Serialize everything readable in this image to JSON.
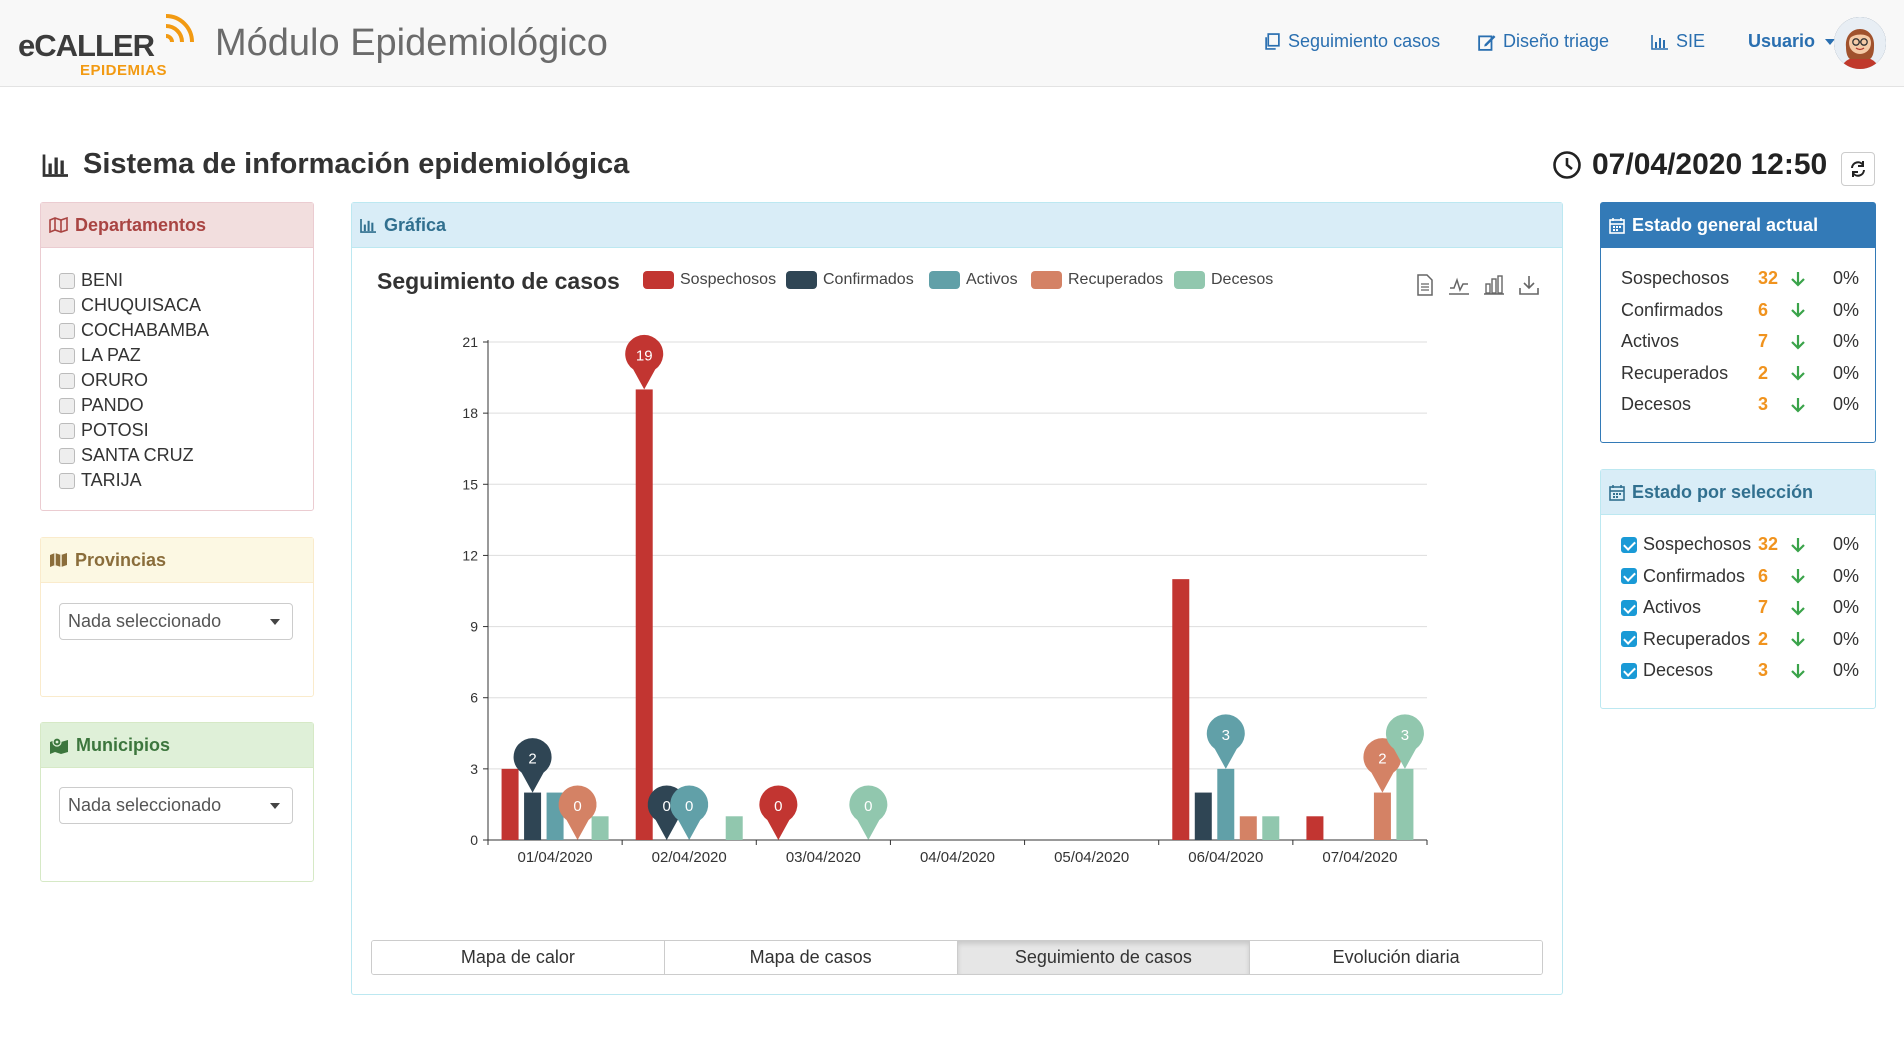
{
  "header": {
    "logo_text": "eCALLER",
    "logo_sub": "EPIDEMIAS",
    "app_title": "Módulo Epidemiológico",
    "nav": [
      {
        "label": "Seguimiento casos",
        "icon": "copy-icon"
      },
      {
        "label": "Diseño triage",
        "icon": "edit-icon"
      },
      {
        "label": "SIE",
        "icon": "bar-chart-icon"
      }
    ],
    "user_label": "Usuario"
  },
  "page": {
    "title": "Sistema de información epidemiológica",
    "datetime": "07/04/2020 12:50"
  },
  "departamentos": {
    "title": "Departamentos",
    "items": [
      "BENI",
      "CHUQUISACA",
      "COCHABAMBA",
      "LA PAZ",
      "ORURO",
      "PANDO",
      "POTOSI",
      "SANTA CRUZ",
      "TARIJA"
    ]
  },
  "provincias": {
    "title": "Provincias",
    "select_value": "Nada seleccionado"
  },
  "municipios": {
    "title": "Municipios",
    "select_value": "Nada seleccionado"
  },
  "grafica": {
    "title": "Gráfica",
    "tabs": [
      "Mapa de calor",
      "Mapa de casos",
      "Seguimiento de casos",
      "Evolución diaria"
    ],
    "active_tab": "Seguimiento de casos"
  },
  "chart_data": {
    "type": "bar",
    "title": "Seguimiento de casos",
    "categories": [
      "01/04/2020",
      "02/04/2020",
      "03/04/2020",
      "04/04/2020",
      "05/04/2020",
      "06/04/2020",
      "07/04/2020"
    ],
    "ylim": [
      0,
      21
    ],
    "yticks": [
      "0",
      "3",
      "6",
      "9",
      "12",
      "15",
      "18",
      "21"
    ],
    "grid": true,
    "legend_position": "top",
    "series": [
      {
        "name": "Sospechosos",
        "color": "#c23531",
        "values": [
          3,
          19,
          0,
          0,
          0,
          11,
          1
        ],
        "markers": [
          null,
          "19",
          "0",
          null,
          null,
          null,
          null
        ]
      },
      {
        "name": "Confirmados",
        "color": "#2f4554",
        "values": [
          2,
          0,
          0,
          0,
          0,
          2,
          0
        ],
        "markers": [
          "2",
          "0",
          null,
          null,
          null,
          null,
          null
        ]
      },
      {
        "name": "Activos",
        "color": "#61a0a8",
        "values": [
          2,
          0,
          0,
          0,
          0,
          3,
          0
        ],
        "markers": [
          null,
          "0",
          null,
          null,
          null,
          "3",
          null
        ]
      },
      {
        "name": "Recuperados",
        "color": "#d48265",
        "values": [
          0,
          0,
          0,
          0,
          0,
          1,
          2
        ],
        "markers": [
          "0",
          null,
          null,
          null,
          null,
          null,
          "2"
        ]
      },
      {
        "name": "Decesos",
        "color": "#91c7ae",
        "values": [
          1,
          1,
          0,
          0,
          0,
          1,
          3
        ],
        "markers": [
          null,
          null,
          "0",
          null,
          null,
          null,
          "3"
        ]
      }
    ]
  },
  "estado_general": {
    "title": "Estado general actual",
    "rows": [
      {
        "label": "Sospechosos",
        "value": "32",
        "pct": "0%"
      },
      {
        "label": "Confirmados",
        "value": "6",
        "pct": "0%"
      },
      {
        "label": "Activos",
        "value": "7",
        "pct": "0%"
      },
      {
        "label": "Recuperados",
        "value": "2",
        "pct": "0%"
      },
      {
        "label": "Decesos",
        "value": "3",
        "pct": "0%"
      }
    ]
  },
  "estado_seleccion": {
    "title": "Estado por selección",
    "rows": [
      {
        "label": "Sospechosos",
        "value": "32",
        "pct": "0%"
      },
      {
        "label": "Confirmados",
        "value": "6",
        "pct": "0%"
      },
      {
        "label": "Activos",
        "value": "7",
        "pct": "0%"
      },
      {
        "label": "Recuperados",
        "value": "2",
        "pct": "0%"
      },
      {
        "label": "Decesos",
        "value": "3",
        "pct": "0%"
      }
    ]
  },
  "colors": {
    "accent": "#337ab7",
    "value_orange": "#f0931e",
    "arrow_green": "#3aa34a"
  }
}
